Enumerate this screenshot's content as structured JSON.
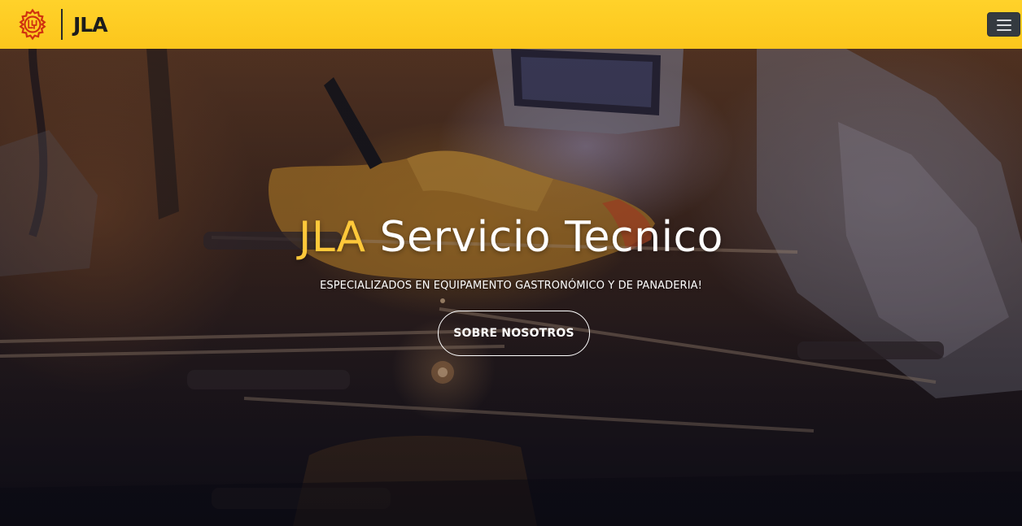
{
  "navbar": {
    "brand_text": "JLA",
    "logo_icon": "gear-logo-icon",
    "menu_icon": "hamburger-menu-icon",
    "background_color": "#fcc61c"
  },
  "hero": {
    "title_accent": "JLA",
    "title_main": "Servicio Tecnico",
    "subtitle": "ESPECIALIZADOS EN EQUIPAMENTO GASTRONÓMICO Y DE PANADERIA!",
    "cta_label": "SOBRE NOSOTROS",
    "accent_color": "#ffc83a"
  }
}
